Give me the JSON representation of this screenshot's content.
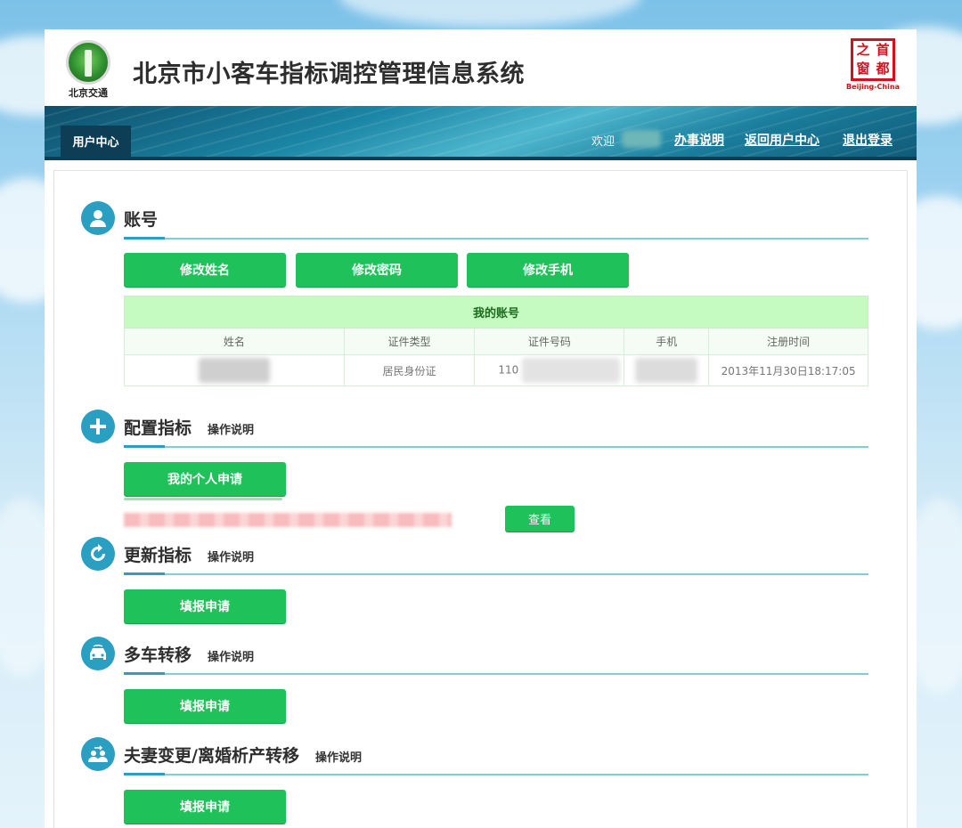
{
  "header": {
    "title": "北京市小客车指标调控管理信息系统",
    "left_logo_caption": "北京交通",
    "right_logo_chars": [
      "之",
      "首",
      "窗",
      "都"
    ],
    "right_logo_caption": "Beijing-China"
  },
  "nav": {
    "tab": "用户中心",
    "welcome": "欢迎",
    "links": [
      "办事说明",
      "返回用户中心",
      "退出登录"
    ]
  },
  "account": {
    "title": "账号",
    "buttons": [
      "修改姓名",
      "修改密码",
      "修改手机"
    ],
    "table_caption": "我的账号",
    "columns": [
      "姓名",
      "证件类型",
      "证件号码",
      "手机",
      "注册时间"
    ],
    "row": {
      "id_type": "居民身份证",
      "id_prefix": "110",
      "registered": "2013年11月30日18:17:05"
    }
  },
  "config": {
    "title": "配置指标",
    "help": "操作说明",
    "button": "我的个人申请",
    "view_button": "查看"
  },
  "renew": {
    "title": "更新指标",
    "help": "操作说明",
    "button": "填报申请"
  },
  "transfer": {
    "title": "多车转移",
    "help": "操作说明",
    "button": "填报申请"
  },
  "spouse": {
    "title": "夫妻变更/离婚析产转移",
    "help": "操作说明",
    "button": "填报申请"
  },
  "colors": {
    "accent_green": "#1fc15a",
    "accent_blue": "#2a9fc2",
    "table_header_green": "#c5fbc0"
  },
  "icons": [
    "user-icon",
    "plus-icon",
    "refresh-icon",
    "car-transfer-icon",
    "couple-icon"
  ]
}
